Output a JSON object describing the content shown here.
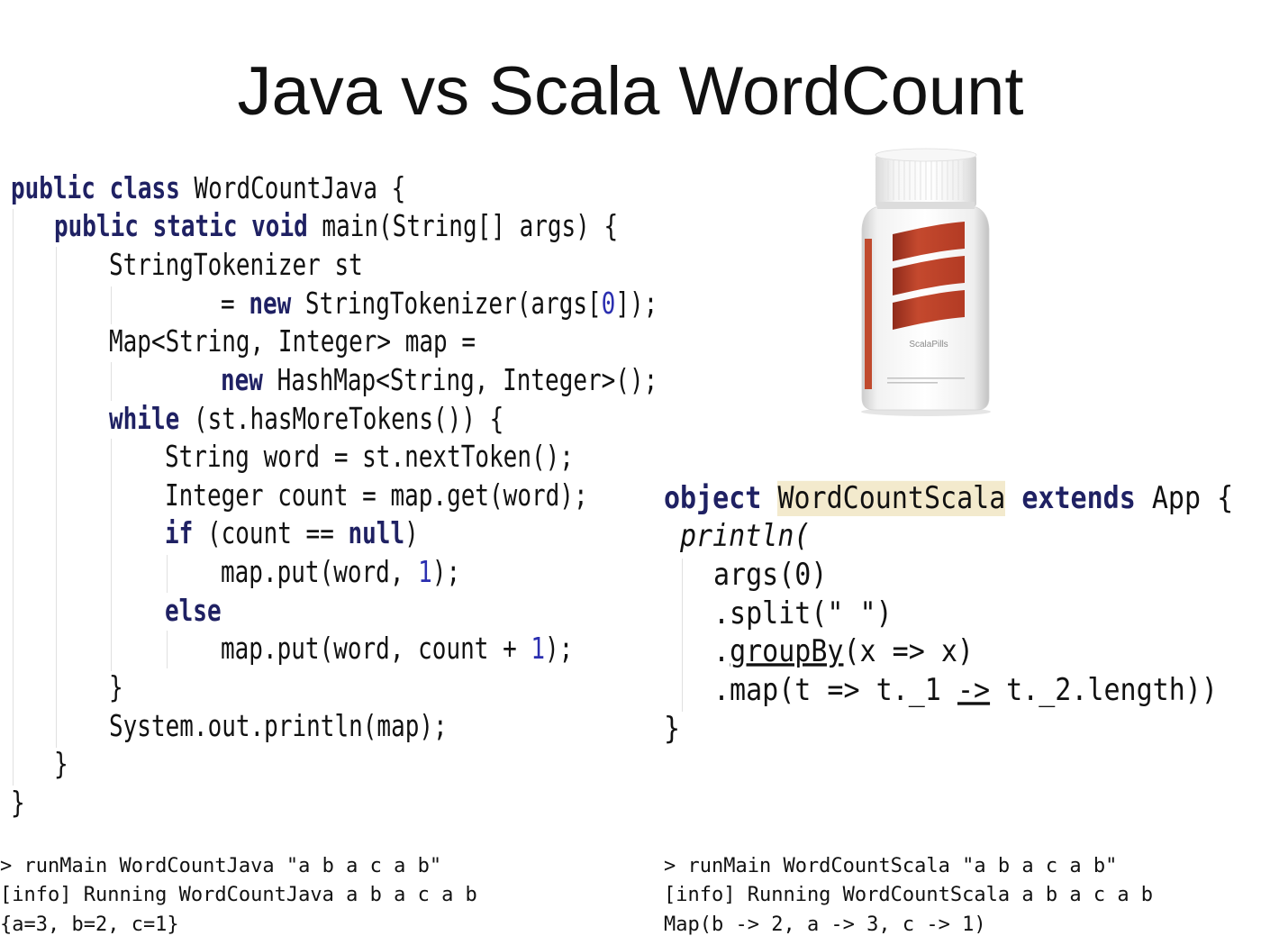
{
  "slide": {
    "title": "Java vs Scala WordCount"
  },
  "colors": {
    "keyword": "#1f2163",
    "number": "#2b2fb0",
    "highlight": "#f3eacd",
    "text": "#111111"
  },
  "java_code": {
    "lines": [
      [
        "public class",
        " WordCountJava {"
      ],
      [
        "public static void",
        " main(String[] args) {"
      ],
      [
        "StringTokenizer st"
      ],
      [
        "= ",
        "new",
        " StringTokenizer(args[",
        "0",
        "]);"
      ],
      [
        "Map<String, Integer> map ="
      ],
      [
        "new",
        " HashMap<String, Integer>();"
      ],
      [
        "while",
        " (st.hasMoreTokens()) {"
      ],
      [
        "String word = st.nextToken();"
      ],
      [
        "Integer count = map.get(word);"
      ],
      [
        "if",
        " (count == ",
        "null",
        ")"
      ],
      [
        "map.put(word, ",
        "1",
        ");"
      ],
      [
        "else"
      ],
      [
        "map.put(word, count + ",
        "1",
        ");"
      ],
      [
        "}"
      ],
      [
        "System.out.println(map);"
      ],
      [
        "}"
      ],
      [
        "}"
      ]
    ]
  },
  "scala_code": {
    "lines": [
      [
        "object ",
        "WordCountScala",
        " extends",
        " App {"
      ],
      [
        "println("
      ],
      [
        "args(0)"
      ],
      [
        ".split(\" \")"
      ],
      [
        ".",
        "groupBy",
        "(x => x)"
      ],
      [
        ".map(t => t._1 ",
        "->",
        " t._2.length))"
      ],
      [
        "}"
      ]
    ]
  },
  "bottle": {
    "label": "ScalaPills"
  },
  "console": {
    "java": [
      "> runMain WordCountJava \"a b a c a b\"",
      "[info] Running WordCountJava a b a c a b",
      "{a=3, b=2, c=1}"
    ],
    "scala": [
      "> runMain WordCountScala \"a b a c a b\"",
      "[info] Running WordCountScala a b a c a b",
      "Map(b -> 2, a -> 3, c -> 1)"
    ]
  }
}
